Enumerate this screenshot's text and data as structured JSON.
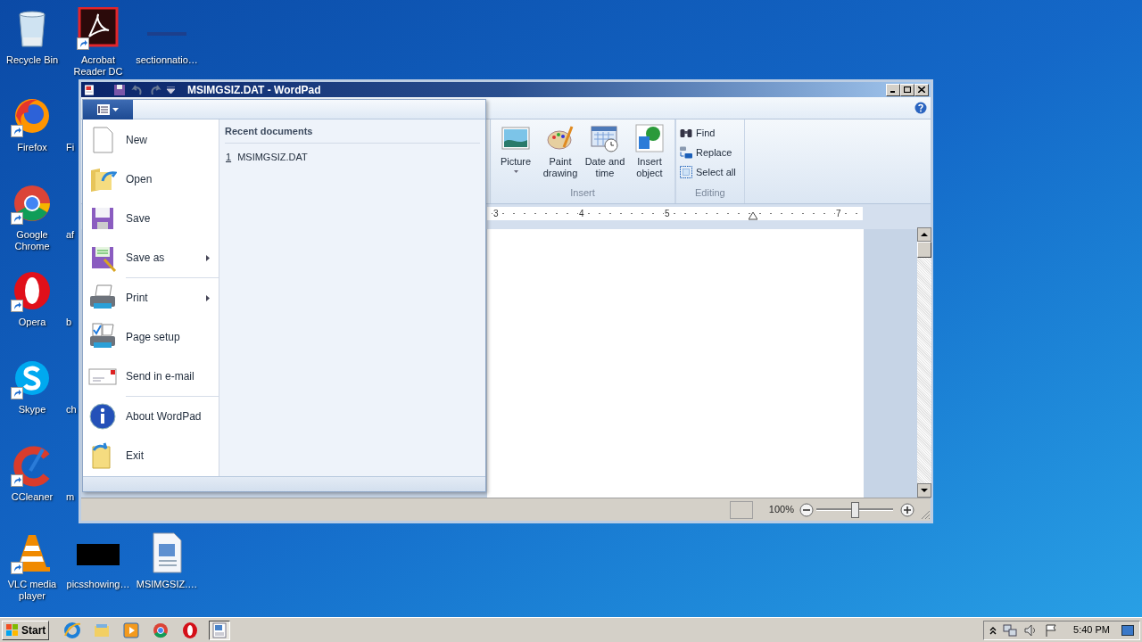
{
  "desktop": {
    "rows": [
      [
        {
          "label": "Recycle Bin",
          "kind": "recycle",
          "shortcut": false
        },
        {
          "label": "Acrobat Reader DC",
          "kind": "acrobat",
          "shortcut": true
        },
        {
          "label": "sectionnatio…",
          "kind": "thumb_blue",
          "shortcut": false
        }
      ],
      [
        {
          "label": "Firefox",
          "kind": "firefox",
          "shortcut": true
        },
        {
          "label": "Fi",
          "kind": "covered"
        }
      ],
      [
        {
          "label": "Google Chrome",
          "kind": "chrome",
          "shortcut": true
        },
        {
          "label": "af",
          "kind": "covered"
        }
      ],
      [
        {
          "label": "Opera",
          "kind": "opera",
          "shortcut": true
        },
        {
          "label": "b",
          "kind": "covered"
        }
      ],
      [
        {
          "label": "Skype",
          "kind": "skype",
          "shortcut": true
        },
        {
          "label": "ch",
          "kind": "covered"
        }
      ],
      [
        {
          "label": "CCleaner",
          "kind": "ccleaner",
          "shortcut": true
        },
        {
          "label": "m",
          "kind": "covered"
        }
      ],
      [
        {
          "label": "VLC media player",
          "kind": "vlc",
          "shortcut": true
        },
        {
          "label": "picsshowing…",
          "kind": "thumb_black",
          "shortcut": false
        },
        {
          "label": "MSIMGSIZ.…",
          "kind": "document",
          "shortcut": false
        }
      ]
    ]
  },
  "window": {
    "title": "MSIMGSIZ.DAT - WordPad",
    "ribbon": {
      "groups": [
        {
          "title": "Insert",
          "kind": "large",
          "buttons": [
            {
              "label": "Picture",
              "kind": "picture",
              "dropdown": true
            },
            {
              "label": "Paint drawing",
              "kind": "paint",
              "dropdown": false
            },
            {
              "label": "Date and time",
              "kind": "calendar",
              "dropdown": false
            },
            {
              "label": "Insert object",
              "kind": "object",
              "dropdown": false
            }
          ]
        },
        {
          "title": "Editing",
          "kind": "small",
          "buttons": [
            {
              "label": "Find",
              "kind": "find"
            },
            {
              "label": "Replace",
              "kind": "replace"
            },
            {
              "label": "Select all",
              "kind": "selectall"
            }
          ]
        }
      ]
    },
    "ruler": [
      {
        "kind": "number",
        "text": "3"
      },
      {
        "kind": "number",
        "text": "4"
      },
      {
        "kind": "number",
        "text": "5"
      },
      {
        "kind": "indent"
      },
      {
        "kind": "number",
        "text": "7"
      }
    ],
    "app_menu": {
      "groups": [
        [
          {
            "label": "New",
            "kind": "new",
            "has_submenu": false
          },
          {
            "label": "Open",
            "kind": "open",
            "has_submenu": false
          },
          {
            "label": "Save",
            "kind": "save",
            "has_submenu": false
          },
          {
            "label": "Save as",
            "kind": "saveas",
            "has_submenu": true
          }
        ],
        [
          {
            "label": "Print",
            "kind": "print",
            "has_submenu": true
          },
          {
            "label": "Page setup",
            "kind": "pagesetup",
            "has_submenu": false
          },
          {
            "label": "Send in e-mail",
            "kind": "mail",
            "has_submenu": false
          }
        ],
        [
          {
            "label": "About WordPad",
            "kind": "about",
            "has_submenu": false
          },
          {
            "label": "Exit",
            "kind": "exit",
            "has_submenu": false
          }
        ]
      ],
      "recent": {
        "heading": "Recent documents",
        "items": [
          {
            "number": "1",
            "name": "MSIMGSIZ.DAT"
          }
        ]
      }
    },
    "status_bar": {
      "zoom": "100%",
      "level": 0.5
    }
  },
  "taskbar": {
    "start": "Start",
    "apps": [
      {
        "kind": "ie",
        "selected": false
      },
      {
        "kind": "explorer",
        "selected": false
      },
      {
        "kind": "media",
        "selected": false
      },
      {
        "kind": "chrome",
        "selected": false
      },
      {
        "kind": "opera",
        "selected": false
      },
      {
        "kind": "wordpad",
        "selected": true
      }
    ],
    "clock": "5:40 PM"
  }
}
